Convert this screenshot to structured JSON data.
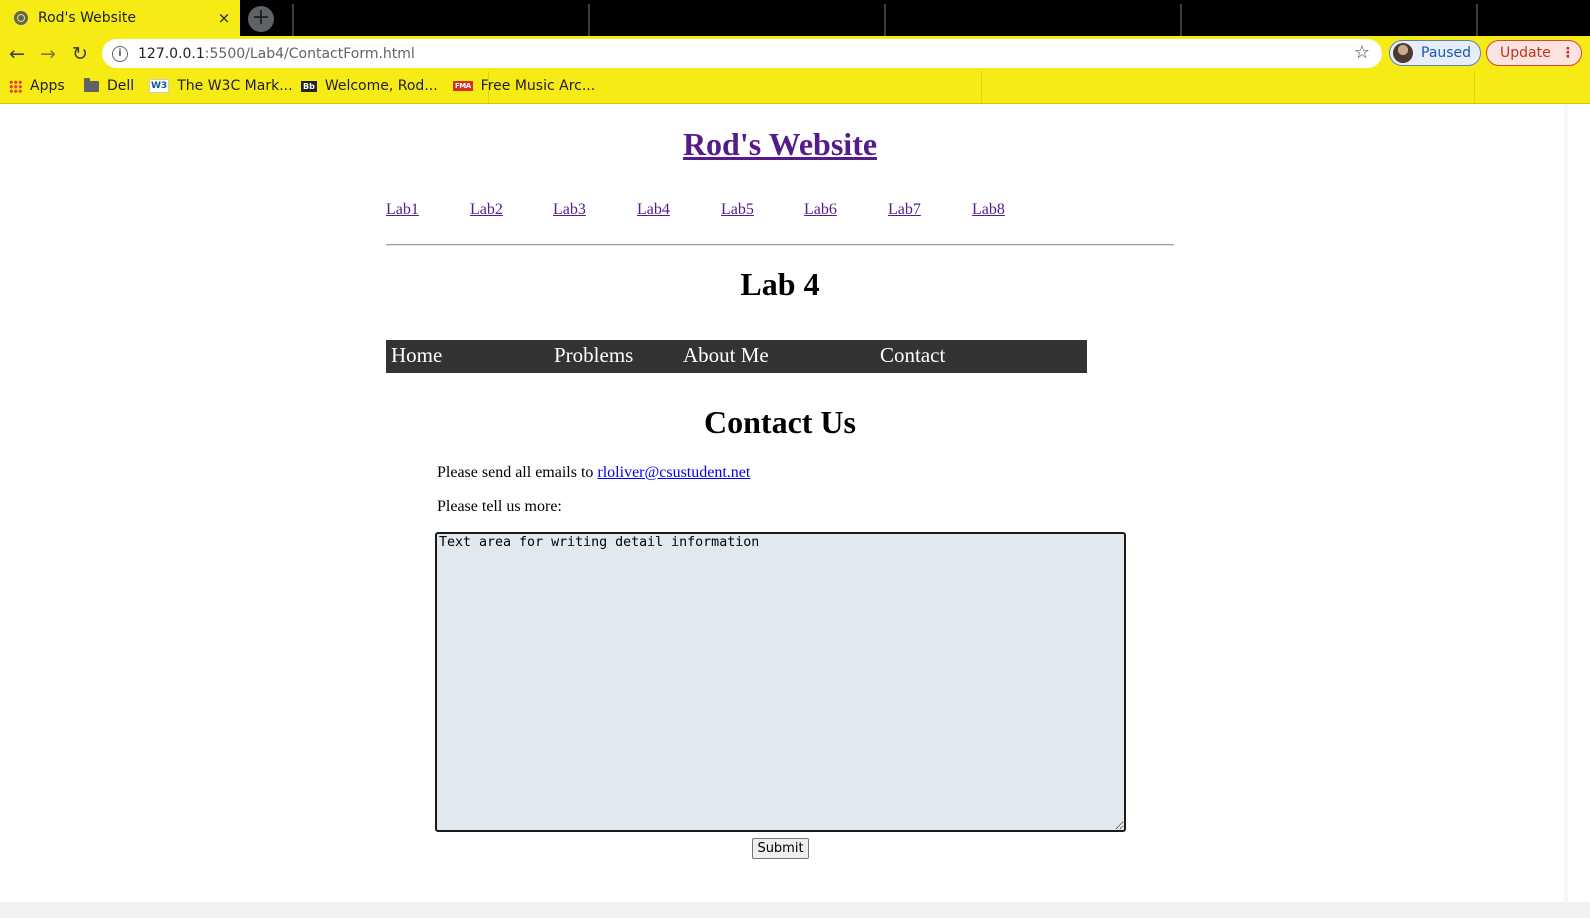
{
  "browser": {
    "tab_title": "Rod's Website",
    "tab_close": "×",
    "new_tab": "+",
    "back": "←",
    "forward": "→",
    "reload": "↻",
    "url_host": "127.0.0.1",
    "url_path": ":5500/Lab4/ContactForm.html",
    "star": "☆",
    "profile_label": "Paused",
    "update_label": "Update",
    "update_menu": "⋮",
    "bookmarks": [
      "Apps",
      "Dell",
      "The W3C Mark...",
      "Welcome, Rod...",
      "Free Music Arc..."
    ],
    "bookmark_icons": [
      "apps-grid-icon",
      "folder-icon",
      "w3c-icon",
      "blackboard-icon",
      "fma-icon"
    ],
    "accent_color": "#f7eb16"
  },
  "page": {
    "site_title": "Rod's Website",
    "lab_links": [
      "Lab1",
      "Lab2",
      "Lab3",
      "Lab4",
      "Lab5",
      "Lab6",
      "Lab7",
      "Lab8"
    ],
    "lab_heading": "Lab 4",
    "menu": [
      "Home",
      "Problems",
      "About Me",
      "Contact"
    ],
    "contact_heading": "Contact Us",
    "email_prefix": "Please send all emails to ",
    "email": "rloliver@csustudent.net",
    "tell_more": "Please tell us more:",
    "textarea_value": "Text area for writing detail information",
    "submit_label": "Submit",
    "link_color": "#551a8b",
    "menu_bg": "#333333",
    "textarea_bg": "#e1e9ef"
  }
}
